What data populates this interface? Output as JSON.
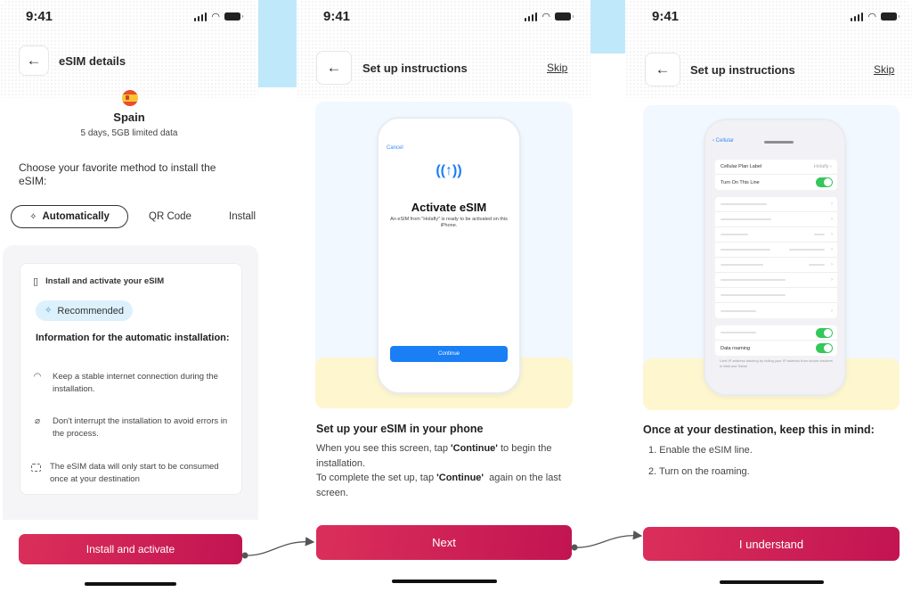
{
  "status_bar": {
    "time": "9:41"
  },
  "screen1": {
    "header_title": "eSIM details",
    "country": "Spain",
    "plan": "5 days, 5GB limited data",
    "choose_text": "Choose your favorite method to install the eSIM:",
    "tabs": [
      {
        "label": "Automatically",
        "selected": true,
        "icon": "sparkle-icon"
      },
      {
        "label": "QR Code",
        "selected": false
      },
      {
        "label": "Install",
        "selected": false
      }
    ],
    "card": {
      "header": "Install and activate your eSIM",
      "badge": "Recommended",
      "info_title": "Information for the automatic installation:",
      "items": [
        {
          "icon": "wifi-icon",
          "text": "Keep a stable internet connection during the installation."
        },
        {
          "icon": "wifi-off-icon",
          "text": "Don't interrupt the installation to avoid errors in the process."
        },
        {
          "icon": "sim-card-icon",
          "text": "The eSIM data will only start to be consumed once at your destination"
        }
      ]
    },
    "cta": "Install and activate"
  },
  "screen2": {
    "header_title": "Set up instructions",
    "skip": "Skip",
    "phone": {
      "cancel": "Cancel",
      "title": "Activate eSIM",
      "subtitle": "An eSIM from \"Holafly\" is ready to be activated on this iPhone.",
      "button": "Continue"
    },
    "step_title": "Set up your eSIM in your phone",
    "body": {
      "p1_a": "When you see this screen, tap ",
      "p1_b": "'Continue'",
      "p1_c": " to begin the installation.",
      "p2_a": "To complete the set up, tap ",
      "p2_b": "'Continue'",
      "p2_c": "  again on the last screen."
    },
    "cta": "Next"
  },
  "screen3": {
    "header_title": "Set up instructions",
    "skip": "Skip",
    "phone": {
      "back": "Cellular",
      "plan_label": "Cellular Plan Label",
      "plan_value": "Holafly",
      "turn_on": "Turn On This Line",
      "turn_on_enabled": true,
      "data_roaming": "Data roaming",
      "data_roaming_enabled": true,
      "footer": "Limit IP address tracking by hiding your IP address from known trackers in Mail and Safari"
    },
    "step_title": "Once at your destination, keep this in mind:",
    "items": [
      "1. Enable the eSIM line.",
      "2. Turn on the roaming."
    ],
    "cta": "I understand"
  },
  "colors": {
    "primary": "#c8184f",
    "accent_blue": "#c0e8fb",
    "ios_blue": "#1a7ef5",
    "ios_green": "#34c759",
    "illustration_yellow": "#fdf6cf"
  }
}
